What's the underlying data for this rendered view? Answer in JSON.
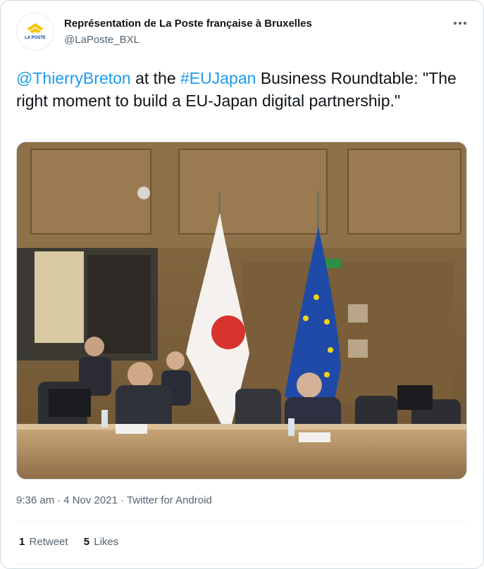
{
  "author": {
    "display_name": "Représentation de La Poste française à Bruxelles",
    "handle": "@LaPoste_BXL",
    "avatar_logo_text": "LA POSTE",
    "avatar_bg": "#ffffff",
    "brand_yellow": "#f6c500",
    "brand_blue": "#003da5"
  },
  "tweet": {
    "mention": "@ThierryBreton",
    "text_1": " at the ",
    "hashtag": "#EUJapan",
    "text_2": " Business Roundtable: \"The right moment to build a EU-Japan digital partnership.\""
  },
  "media": {
    "description_icon": "photo"
  },
  "meta": {
    "time": "9:36 am",
    "separator": "·",
    "date": "4 Nov 2021",
    "source": "Twitter for Android"
  },
  "stats": {
    "retweets_count": "1",
    "retweets_label": "Retweet",
    "likes_count": "5",
    "likes_label": "Likes"
  },
  "colors": {
    "link": "#1d9bf0",
    "text": "#0f1419",
    "secondary": "#536471",
    "border": "#cfd9de"
  }
}
